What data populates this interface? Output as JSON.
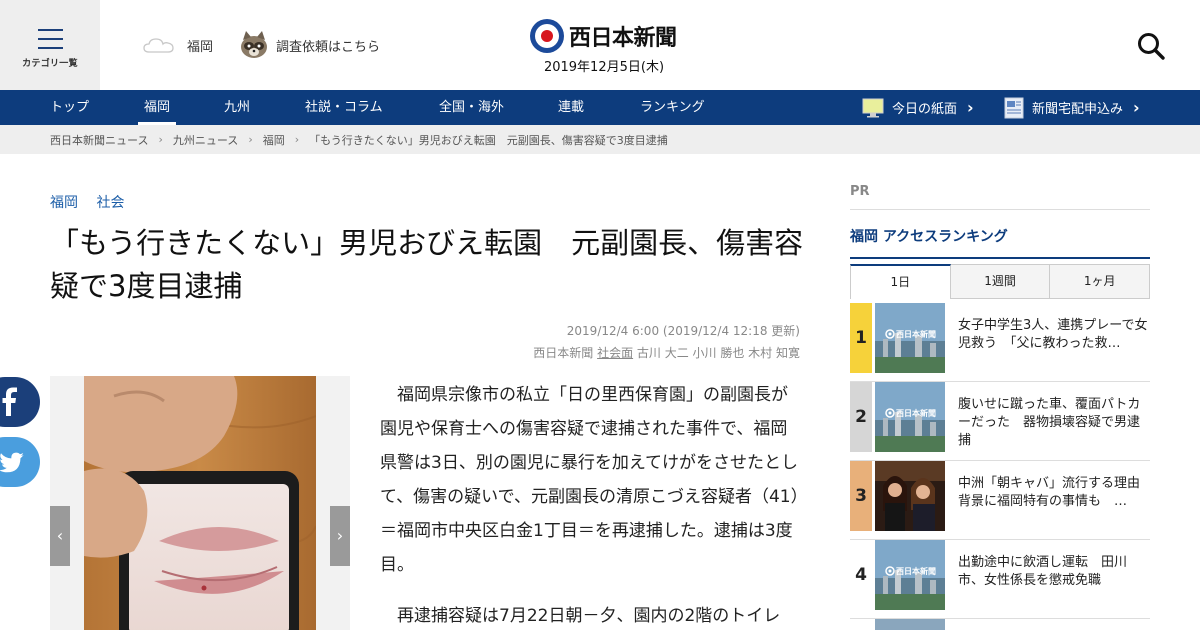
{
  "header": {
    "category_label": "カテゴリ一覧",
    "weather_label": "福岡",
    "request_label": "調査依頼はこちら",
    "logo_text": "西日本新聞",
    "date": "2019年12月5日(木)"
  },
  "nav": {
    "items": [
      "トップ",
      "福岡",
      "九州",
      "社説・コラム",
      "全国・海外",
      "連載",
      "ランキング"
    ],
    "active": "福岡",
    "paper_label": "今日の紙面",
    "delivery_label": "新聞宅配申込み"
  },
  "breadcrumb": [
    "西日本新聞ニュース",
    "九州ニュース",
    "福岡",
    "「もう行きたくない」男児おびえ転園　元副園長、傷害容疑で3度目逮捕"
  ],
  "article": {
    "tags": [
      "福岡",
      "社会"
    ],
    "title": "「もう行きたくない」男児おびえ転園　元副園長、傷害容疑で3度目逮捕",
    "dates": "2019/12/4 6:00 (2019/12/4 12:18 更新)",
    "source": "西日本新聞",
    "section_link": "社会面",
    "authors": "古川 大二 小川 勝也 木村 知寛",
    "paragraphs": [
      "福岡県宗像市の私立「日の里西保育園」の副園長が園児や保育士への傷害容疑で逮捕された事件で、福岡県警は3日、別の園児に暴行を加えてけがをさせたとして、傷害の疑いで、元副園長の清原こづえ容疑者（41）＝福岡市中央区白金1丁目＝を再逮捕した。逮捕は3度目。",
      "再逮捕容疑は7月22日朝－夕、園内の2階のトイレ"
    ],
    "gallery_prev": "‹",
    "gallery_next": "›"
  },
  "sidebar": {
    "pr_label": "PR",
    "ranking_title": "福岡 アクセスランキング",
    "tabs": [
      "1日",
      "1週間",
      "1ヶ月"
    ],
    "active_tab": "1日",
    "thumb_logo": "西日本新聞",
    "rankings": [
      {
        "rank": "1",
        "title": "女子中学生3人、連携プレーで女児救う　「父に教わった救…",
        "badge_color": "#f6d23a"
      },
      {
        "rank": "2",
        "title": "腹いせに蹴った車、覆面パトカーだった　器物損壊容疑で男逮捕",
        "badge_color": "#d6d6d6"
      },
      {
        "rank": "3",
        "title": "中洲「朝キャバ」流行する理由　背景に福岡特有の事情も　…",
        "badge_color": "#e8b07a"
      },
      {
        "rank": "4",
        "title": "出勤途中に飲酒し運転　田川市、女性係長を懲戒免職",
        "badge_color": "#ffffff"
      }
    ]
  },
  "colors": {
    "nav_bg": "#0d3c7d",
    "accent": "#1c5ea8",
    "facebook": "#1b3f7a",
    "twitter": "#4a9ede"
  }
}
